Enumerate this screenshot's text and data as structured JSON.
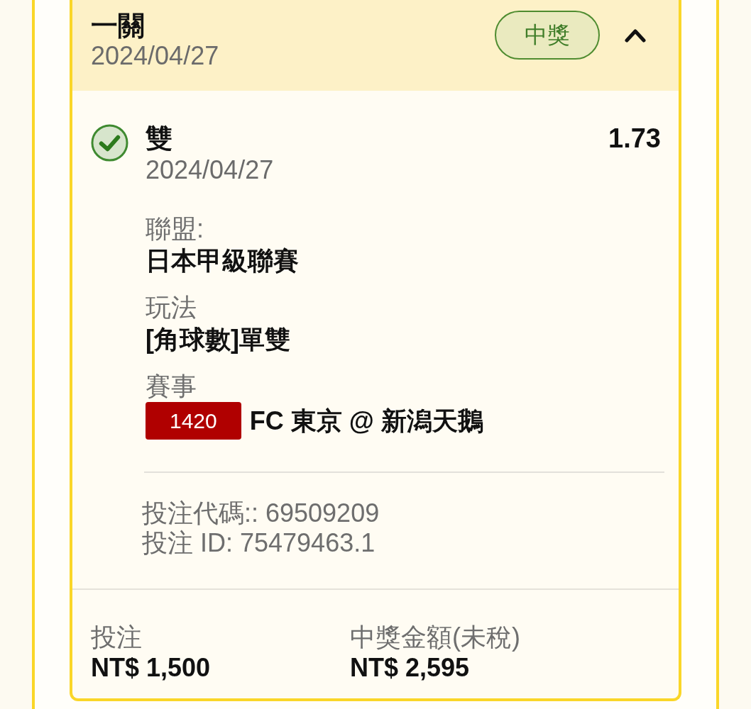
{
  "bet": {
    "title": "一關",
    "date": "2024/04/27",
    "badge": "中獎",
    "expanded": true
  },
  "selection": {
    "won": true,
    "pick": "雙",
    "date": "2024/04/27",
    "odds": "1.73",
    "fields": [
      {
        "label": "聯盟:",
        "value": "日本甲級聯賽"
      },
      {
        "label": "玩法",
        "value": "[角球數]單雙"
      },
      {
        "label": "賽事",
        "match_code": "1420",
        "value": "FC 東京 @ 新潟天鵝"
      }
    ],
    "references": [
      "投注代碼:: 69509209",
      "投注 ID: 75479463.1"
    ]
  },
  "summary": [
    {
      "label": "投注",
      "amount": "NT$ 1,500"
    },
    {
      "label": "中獎金額(未稅)",
      "amount": "NT$ 2,595"
    }
  ]
}
